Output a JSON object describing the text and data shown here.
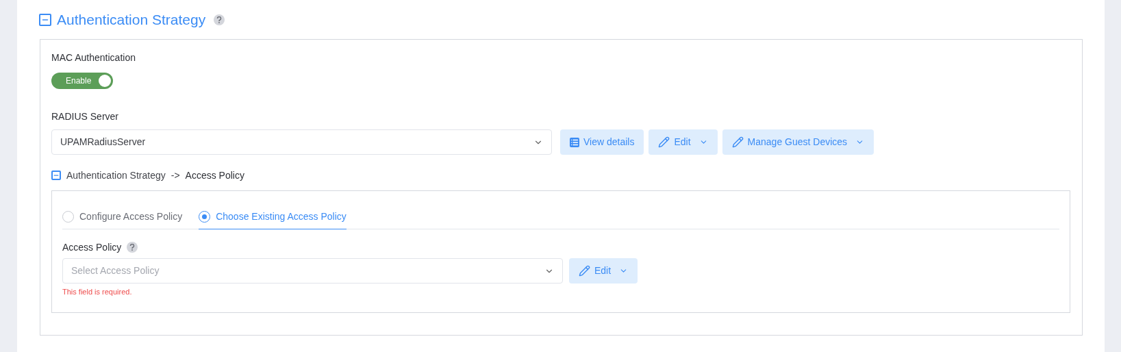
{
  "section": {
    "title": "Authentication Strategy",
    "expanded": true
  },
  "mac_authentication": {
    "label": "MAC Authentication",
    "toggle": {
      "label": "Enable",
      "on": true
    }
  },
  "radius_server": {
    "label": "RADIUS Server",
    "value": "UPAMRadiusServer",
    "buttons": [
      {
        "label": "View details",
        "kind": "list",
        "caret": false
      },
      {
        "label": "Edit",
        "kind": "pencil",
        "caret": true
      },
      {
        "label": "Manage Guest Devices",
        "kind": "pencil",
        "caret": true
      }
    ]
  },
  "subsection": {
    "expanded": true,
    "path": "Authentication Strategy",
    "arrow": "->",
    "current": "Access Policy"
  },
  "tabs": [
    {
      "label": "Configure Access Policy",
      "selected": false
    },
    {
      "label": "Choose Existing Access Policy",
      "selected": true
    }
  ],
  "access_policy": {
    "label": "Access Policy",
    "placeholder": "Select Access Policy",
    "error": "This field is required.",
    "buttons": [
      {
        "label": "Edit",
        "kind": "pencil",
        "caret": true
      }
    ]
  }
}
